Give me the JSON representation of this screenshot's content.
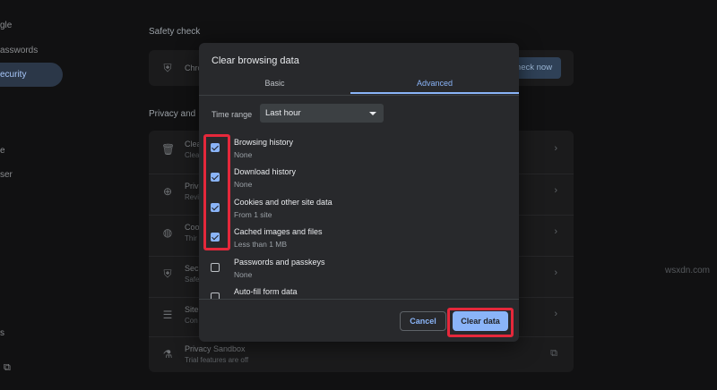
{
  "background": {
    "sidebar": [
      {
        "label": "gle"
      },
      {
        "label": "asswords"
      },
      {
        "label": "ecurity"
      },
      {
        "label": "e"
      },
      {
        "label": "ser"
      },
      {
        "label": "s"
      }
    ],
    "safety_check_title": "Safety check",
    "safety_check_row": {
      "title": "Chro",
      "button": "heck now"
    },
    "privacy_title": "Privacy and",
    "privacy_rows": [
      {
        "title": "Clea",
        "sub": "Clea",
        "icon": "trash-icon"
      },
      {
        "title": "Priva",
        "sub": "Revi",
        "icon": "privacy-guide-icon"
      },
      {
        "title": "Coo",
        "sub": "Thir",
        "icon": "cookie-icon"
      },
      {
        "title": "Secu",
        "sub": "Safe",
        "icon": "shield-icon"
      },
      {
        "title": "Site",
        "sub": "Con",
        "icon": "tune-icon"
      },
      {
        "title": "Privacy Sandbox",
        "sub": "Trial features are off",
        "icon": "flask-icon"
      }
    ],
    "watermark": "wsxdn.com"
  },
  "dialog": {
    "title": "Clear browsing data",
    "tabs": [
      {
        "label": "Basic",
        "active": false
      },
      {
        "label": "Advanced",
        "active": true
      }
    ],
    "time_range": {
      "label": "Time range",
      "value": "Last hour"
    },
    "items": [
      {
        "title": "Browsing history",
        "sub": "None",
        "checked": true
      },
      {
        "title": "Download history",
        "sub": "None",
        "checked": true
      },
      {
        "title": "Cookies and other site data",
        "sub": "From 1 site",
        "checked": true
      },
      {
        "title": "Cached images and files",
        "sub": "Less than 1 MB",
        "checked": true
      },
      {
        "title": "Passwords and passkeys",
        "sub": "None",
        "checked": false
      },
      {
        "title": "Auto-fill form data",
        "sub": "",
        "checked": false
      }
    ],
    "cancel_label": "Cancel",
    "clear_label": "Clear data"
  },
  "colors": {
    "accent": "#8ab4f8",
    "highlight": "#e5283b",
    "dialog_bg": "#28292c"
  }
}
